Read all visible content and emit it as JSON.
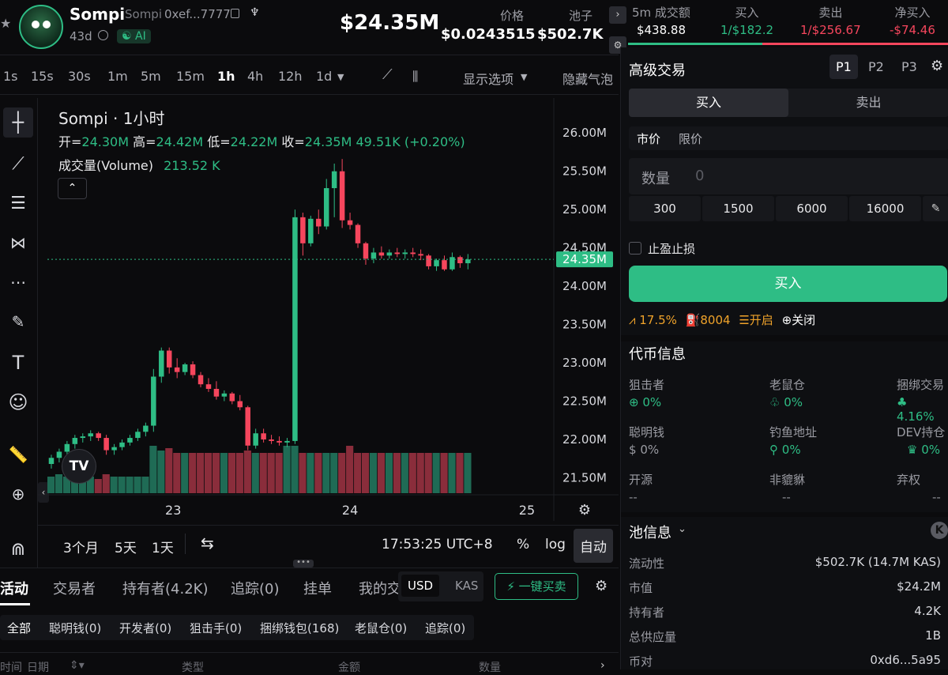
{
  "token": {
    "name": "Sompi",
    "symbol": "Sompi",
    "address": "0xef...7777",
    "age": "43d",
    "ai_badge": "AI",
    "market_cap": "$24.35M",
    "price_label": "价格",
    "price": "$0.0243515",
    "pool_label": "池子",
    "pool": "$502.7K"
  },
  "stats": {
    "window_label": "5m 成交额",
    "window_value": "$438.88",
    "buy_label": "买入",
    "buy_value": "1/$182.2",
    "sell_label": "卖出",
    "sell_value": "1/$256.67",
    "net_label": "净买入",
    "net_value": "-$74.46"
  },
  "timeframes": [
    "1s",
    "15s",
    "30s",
    "1m",
    "5m",
    "15m",
    "1h",
    "4h",
    "12h",
    "1d"
  ],
  "active_timeframe": "1h",
  "chart_toolbar": {
    "display_options": "显示选项",
    "hide_bubbles": "隐藏气泡"
  },
  "chart_legend": {
    "title": "Sompi · 1小时",
    "open_label": "开=",
    "open": "24.30M",
    "high_label": "高=",
    "high": "24.42M",
    "low_label": "低=",
    "low": "24.22M",
    "close_label": "收=",
    "close": "24.35M",
    "change": "49.51K (+0.20%)",
    "volume_label": "成交量(Volume)",
    "volume": "213.52 K",
    "current_price_tag": "24.35M"
  },
  "chart_data": {
    "type": "candlestick",
    "title": "Sompi · 1小时",
    "y_ticks": [
      "26.00M",
      "25.50M",
      "25.00M",
      "24.50M",
      "24.00M",
      "23.50M",
      "23.00M",
      "22.50M",
      "22.00M",
      "21.50M"
    ],
    "ylim": [
      21.35,
      26.25
    ],
    "x_ticks": [
      "23",
      "24",
      "25"
    ],
    "candles": [
      {
        "o": 21.68,
        "h": 21.8,
        "l": 21.62,
        "c": 21.76
      },
      {
        "o": 21.76,
        "h": 21.88,
        "l": 21.7,
        "c": 21.84
      },
      {
        "o": 21.84,
        "h": 21.98,
        "l": 21.78,
        "c": 21.94
      },
      {
        "o": 21.94,
        "h": 22.06,
        "l": 21.88,
        "c": 22.02
      },
      {
        "o": 22.02,
        "h": 22.08,
        "l": 21.96,
        "c": 22.04
      },
      {
        "o": 22.04,
        "h": 22.12,
        "l": 21.98,
        "c": 22.08
      },
      {
        "o": 22.08,
        "h": 22.1,
        "l": 21.98,
        "c": 22.02
      },
      {
        "o": 22.02,
        "h": 22.06,
        "l": 21.8,
        "c": 21.86
      },
      {
        "o": 21.86,
        "h": 21.94,
        "l": 21.8,
        "c": 21.9
      },
      {
        "o": 21.9,
        "h": 22.0,
        "l": 21.86,
        "c": 21.96
      },
      {
        "o": 21.96,
        "h": 22.06,
        "l": 21.92,
        "c": 22.02
      },
      {
        "o": 22.02,
        "h": 22.14,
        "l": 21.98,
        "c": 22.1
      },
      {
        "o": 22.1,
        "h": 22.22,
        "l": 22.04,
        "c": 22.18
      },
      {
        "o": 22.18,
        "h": 22.92,
        "l": 22.1,
        "c": 22.82
      },
      {
        "o": 22.82,
        "h": 23.2,
        "l": 22.74,
        "c": 23.16
      },
      {
        "o": 23.16,
        "h": 23.2,
        "l": 22.86,
        "c": 22.94
      },
      {
        "o": 22.94,
        "h": 23.06,
        "l": 22.8,
        "c": 22.88
      },
      {
        "o": 22.88,
        "h": 23.0,
        "l": 22.84,
        "c": 22.98
      },
      {
        "o": 22.98,
        "h": 23.02,
        "l": 22.8,
        "c": 22.84
      },
      {
        "o": 22.84,
        "h": 22.88,
        "l": 22.68,
        "c": 22.72
      },
      {
        "o": 22.72,
        "h": 22.8,
        "l": 22.62,
        "c": 22.66
      },
      {
        "o": 22.66,
        "h": 22.76,
        "l": 22.52,
        "c": 22.56
      },
      {
        "o": 22.56,
        "h": 22.64,
        "l": 22.5,
        "c": 22.6
      },
      {
        "o": 22.6,
        "h": 22.62,
        "l": 22.46,
        "c": 22.5
      },
      {
        "o": 22.5,
        "h": 22.58,
        "l": 22.38,
        "c": 22.42
      },
      {
        "o": 22.42,
        "h": 22.44,
        "l": 21.86,
        "c": 21.92
      },
      {
        "o": 21.92,
        "h": 22.14,
        "l": 21.88,
        "c": 22.08
      },
      {
        "o": 22.08,
        "h": 22.14,
        "l": 21.96,
        "c": 22.0
      },
      {
        "o": 22.0,
        "h": 22.06,
        "l": 21.94,
        "c": 21.98
      },
      {
        "o": 21.98,
        "h": 22.04,
        "l": 21.92,
        "c": 21.96
      },
      {
        "o": 21.96,
        "h": 22.02,
        "l": 21.9,
        "c": 21.98
      },
      {
        "o": 21.98,
        "h": 25.0,
        "l": 21.94,
        "c": 24.9
      },
      {
        "o": 24.9,
        "h": 24.96,
        "l": 24.4,
        "c": 24.56
      },
      {
        "o": 24.56,
        "h": 24.92,
        "l": 24.52,
        "c": 24.88
      },
      {
        "o": 24.88,
        "h": 25.0,
        "l": 24.68,
        "c": 24.78
      },
      {
        "o": 24.78,
        "h": 25.4,
        "l": 24.74,
        "c": 25.28
      },
      {
        "o": 25.28,
        "h": 25.6,
        "l": 24.9,
        "c": 25.5
      },
      {
        "o": 25.5,
        "h": 25.66,
        "l": 24.76,
        "c": 24.86
      },
      {
        "o": 24.86,
        "h": 24.96,
        "l": 24.74,
        "c": 24.8
      },
      {
        "o": 24.8,
        "h": 24.82,
        "l": 24.5,
        "c": 24.56
      },
      {
        "o": 24.56,
        "h": 24.58,
        "l": 24.28,
        "c": 24.36
      },
      {
        "o": 24.36,
        "h": 24.5,
        "l": 24.3,
        "c": 24.44
      },
      {
        "o": 24.44,
        "h": 24.52,
        "l": 24.36,
        "c": 24.4
      },
      {
        "o": 24.4,
        "h": 24.48,
        "l": 24.36,
        "c": 24.44
      },
      {
        "o": 24.44,
        "h": 24.5,
        "l": 24.38,
        "c": 24.42
      },
      {
        "o": 24.42,
        "h": 24.48,
        "l": 24.36,
        "c": 24.44
      },
      {
        "o": 24.44,
        "h": 24.5,
        "l": 24.38,
        "c": 24.42
      },
      {
        "o": 24.42,
        "h": 24.48,
        "l": 24.34,
        "c": 24.4
      },
      {
        "o": 24.4,
        "h": 24.42,
        "l": 24.22,
        "c": 24.26
      },
      {
        "o": 24.26,
        "h": 24.36,
        "l": 24.2,
        "c": 24.34
      },
      {
        "o": 24.34,
        "h": 24.4,
        "l": 24.2,
        "c": 24.22
      },
      {
        "o": 24.22,
        "h": 24.44,
        "l": 24.2,
        "c": 24.38
      },
      {
        "o": 24.38,
        "h": 24.4,
        "l": 24.24,
        "c": 24.3
      },
      {
        "o": 24.3,
        "h": 24.42,
        "l": 24.22,
        "c": 24.35
      }
    ],
    "volumes": [
      0.35,
      0.4,
      0.35,
      0.35,
      0.35,
      0.35,
      0.3,
      0.4,
      0.35,
      0.35,
      0.35,
      0.35,
      0.35,
      1,
      0.9,
      0.95,
      0.85,
      0.85,
      0.85,
      0.85,
      0.85,
      0.85,
      0.85,
      0.85,
      0.85,
      0.9,
      0.85,
      0.85,
      0.85,
      0.85,
      1,
      1,
      0.85,
      0.85,
      0.85,
      0.85,
      0.85,
      0.85,
      1,
      0.85,
      0.85,
      0.85,
      0.85,
      0.85,
      0.85,
      0.85,
      0.85,
      0.85,
      0.85,
      0.85,
      0.85,
      0.85,
      0.85,
      0.85
    ],
    "grid": false
  },
  "chart_bottom": {
    "range_3m": "3个月",
    "range_5d": "5天",
    "range_1d": "1天",
    "clock": "17:53:25 UTC+8",
    "percent": "%",
    "log": "log",
    "auto": "自动"
  },
  "bottom_tabs": [
    "活动",
    "交易者",
    "持有者(4.2K)",
    "追踪(0)",
    "挂单",
    "我的交"
  ],
  "currency_toggle": [
    "USD",
    "KAS"
  ],
  "one_click": "一键买卖",
  "filters": [
    "全部",
    "聪明钱(0)",
    "开发者(0)",
    "狙击手(0)",
    "捆绑钱包(168)",
    "老鼠仓(0)",
    "追踪(0)"
  ],
  "columns": [
    "时间",
    "日期",
    "类型",
    "金额",
    "数量"
  ],
  "trade": {
    "title": "高级交易",
    "presets": [
      "P1",
      "P2",
      "P3"
    ],
    "buy_tab": "买入",
    "sell_tab": "卖出",
    "market": "市价",
    "limit": "限价",
    "qty_label": "数量",
    "qty_placeholder": "0",
    "quick_amounts": [
      "300",
      "1500",
      "6000",
      "16000"
    ],
    "tp_sl": "止盈止损",
    "buy_button": "买入",
    "slippage": "17.5%",
    "gas": "8004",
    "mev_on": "开启",
    "anti_mev": "关闭"
  },
  "token_info": {
    "title": "代币信息",
    "items": [
      {
        "label": "狙击者",
        "value": "0%"
      },
      {
        "label": "老鼠仓",
        "value": "0%"
      },
      {
        "label": "捆绑交易",
        "value": "4.16%"
      },
      {
        "label": "聪明钱",
        "value": "0%"
      },
      {
        "label": "钓鱼地址",
        "value": "0%"
      },
      {
        "label": "DEV持仓",
        "value": "0%"
      },
      {
        "label": "开源",
        "value": "--"
      },
      {
        "label": "非貔貅",
        "value": "--"
      },
      {
        "label": "弃权",
        "value": "--"
      }
    ]
  },
  "pool_info": {
    "title": "池信息",
    "rows": [
      {
        "label": "流动性",
        "value": "$502.7K (14.7M KAS)"
      },
      {
        "label": "市值",
        "value": "$24.2M"
      },
      {
        "label": "持有者",
        "value": "4.2K"
      },
      {
        "label": "总供应量",
        "value": "1B"
      },
      {
        "label": "币对",
        "value": "0xd6...5a95"
      }
    ]
  },
  "colors": {
    "up": "#2ebd85",
    "down": "#f6465d",
    "bg": "#0b0b0d"
  }
}
